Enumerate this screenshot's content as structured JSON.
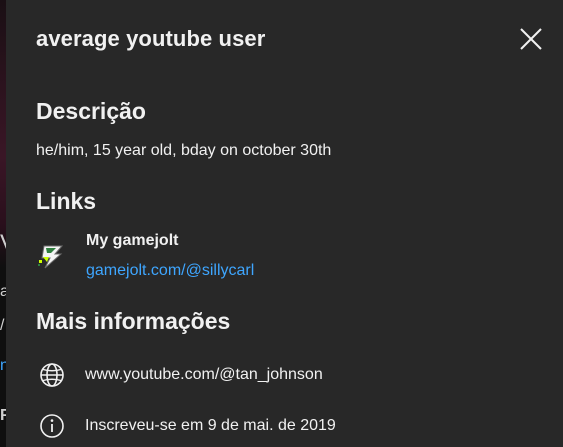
{
  "background": {
    "glyphs": [
      "V",
      "a",
      "/",
      "n",
      "F"
    ]
  },
  "dialog": {
    "title": "average youtube user",
    "close_icon": "close-icon"
  },
  "description": {
    "heading": "Descrição",
    "text": "he/him, 15 year old, bday on october 30th"
  },
  "links": {
    "heading": "Links",
    "items": [
      {
        "title": "My gamejolt",
        "url": "gamejolt.com/@sillycarl",
        "icon": "gamejolt-favicon-icon"
      }
    ]
  },
  "more_info": {
    "heading": "Mais informações",
    "channel_url": "www.youtube.com/@tan_johnson",
    "channel_icon": "globe-icon",
    "joined": "Inscreveu-se em 9 de mai. de 2019",
    "joined_icon": "info-icon"
  },
  "colors": {
    "dialog_bg": "#282828",
    "text": "#f1f1f1",
    "link": "#3ea6ff"
  }
}
